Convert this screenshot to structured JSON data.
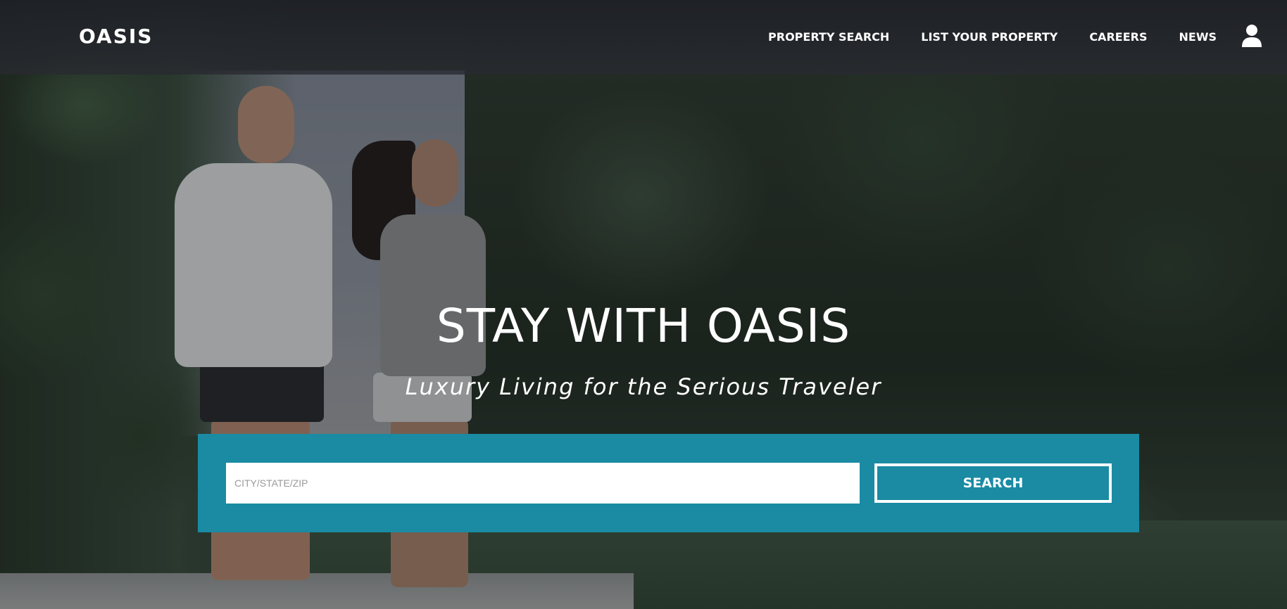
{
  "header": {
    "logo_text": "OASIS",
    "nav": [
      {
        "label": "PROPERTY SEARCH"
      },
      {
        "label": "LIST YOUR PROPERTY"
      },
      {
        "label": "CAREERS"
      },
      {
        "label": "NEWS"
      }
    ],
    "user_icon": "user-icon"
  },
  "hero": {
    "title": "STAY WITH OASIS",
    "subtitle": "Luxury Living for the Serious Traveler",
    "background_image": "runners-in-park-photo"
  },
  "search": {
    "placeholder": "CITY/STATE/ZIP",
    "value": "",
    "button_label": "SEARCH"
  },
  "colors": {
    "accent": "#1a8ba3",
    "header_bg": "#2a2c32",
    "text": "#ffffff"
  }
}
